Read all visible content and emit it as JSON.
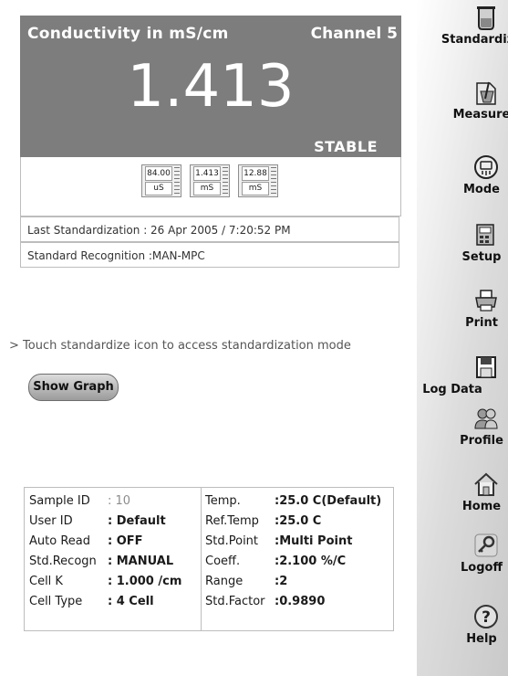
{
  "reading": {
    "title": "Conductivity  in  mS/cm",
    "channel": "Channel 5",
    "value": "1.413",
    "status": "STABLE"
  },
  "standards": [
    {
      "value": "84.00",
      "unit": "uS"
    },
    {
      "value": "1.413",
      "unit": "mS"
    },
    {
      "value": "12.88",
      "unit": "mS"
    }
  ],
  "last_standardization": "Last Standardization   : 26 Apr 2005 / 7:20:52 PM",
  "standard_recognition": "Standard Recognition :MAN-MPC",
  "hint": "> Touch standardize icon to access standardization mode",
  "show_graph_label": "Show Graph",
  "params": {
    "left": [
      {
        "label": "Sample ID",
        "value": ": 10",
        "dim": true
      },
      {
        "label": "User ID",
        "value": ": Default"
      },
      {
        "label": "Auto Read",
        "value": ": OFF"
      },
      {
        "label": "Std.Recogn",
        "value": ": MANUAL"
      },
      {
        "label": "Cell K",
        "value": ": 1.000 /cm"
      },
      {
        "label": "Cell Type",
        "value": ": 4 Cell"
      }
    ],
    "right": [
      {
        "label": "Temp.",
        "value": ":25.0 C(Default)"
      },
      {
        "label": "Ref.Temp",
        "value": ":25.0 C"
      },
      {
        "label": "Std.Point",
        "value": ":Multi Point"
      },
      {
        "label": "Coeff.",
        "value": ":2.100 %/C"
      },
      {
        "label": "Range",
        "value": ":2"
      },
      {
        "label": "Std.Factor",
        "value": ":0.9890"
      }
    ]
  },
  "toolbar": [
    {
      "label": "Standardize",
      "icon": "beaker-icon"
    },
    {
      "label": "Measure",
      "icon": "measure-icon"
    },
    {
      "label": "Mode",
      "icon": "mode-icon"
    },
    {
      "label": "Setup",
      "icon": "setup-icon"
    },
    {
      "label": "Print",
      "icon": "printer-icon"
    },
    {
      "label": "Log Data",
      "icon": "floppy-disk-icon"
    },
    {
      "label": "Profile",
      "icon": "users-icon"
    },
    {
      "label": "Home",
      "icon": "home-icon"
    },
    {
      "label": "Logoff",
      "icon": "key-icon"
    },
    {
      "label": "Help",
      "icon": "help-icon"
    }
  ]
}
